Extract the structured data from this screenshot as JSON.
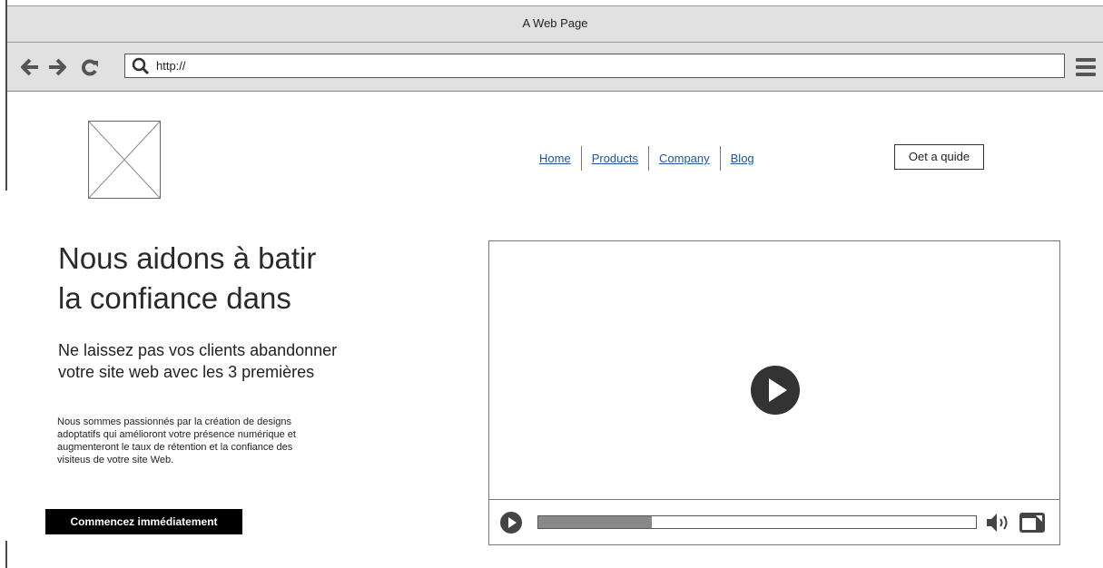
{
  "window": {
    "title": "A Web Page"
  },
  "toolbar": {
    "url": "http://",
    "icons": [
      "back-arrow-icon",
      "forward-arrow-icon",
      "reload-icon",
      "search-icon",
      "hamburger-menu-icon"
    ]
  },
  "site": {
    "nav": [
      {
        "label": "Home"
      },
      {
        "label": "Products"
      },
      {
        "label": "Company"
      },
      {
        "label": "Blog"
      }
    ],
    "guide_button": "Oet a quide"
  },
  "hero": {
    "title_line1": "Nous aidons à batir",
    "title_line2": "la confiance dans",
    "subtitle_line1": "Ne laissez pas vos clients abandonner",
    "subtitle_line2": "votre site web avec les 3 premières",
    "body_line1": "Nous sommes passionnés par la création de designs",
    "body_line2": "adoptatifs qui amélioront votre présence numérique et",
    "body_line3": "augmenteront le taux de rétention et la confiance des",
    "body_line4": "visiteus de votre site Web.",
    "cta": "Commencez immédiatement"
  },
  "video": {
    "progress": 0.26
  },
  "colors": {
    "chrome": "#e1e1e1",
    "link": "#1f55a0",
    "cta_bg": "#000000",
    "cta_text": "#ffffff"
  }
}
